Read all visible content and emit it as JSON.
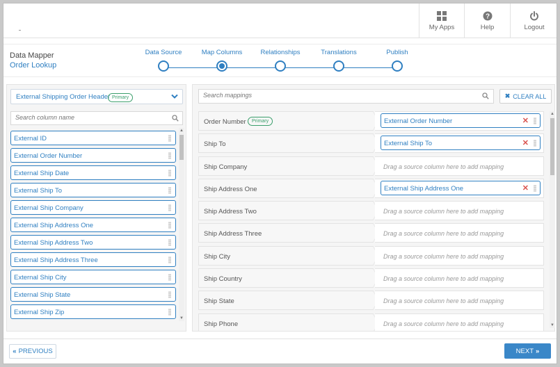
{
  "header": {
    "nav": [
      {
        "label": "My Apps",
        "icon": "grid-icon"
      },
      {
        "label": "Help",
        "icon": "help-icon"
      },
      {
        "label": "Logout",
        "icon": "power-icon"
      }
    ]
  },
  "wizard": {
    "title": "Data Mapper",
    "subtitle": "Order Lookup",
    "steps": [
      {
        "label": "Data Source",
        "active": false
      },
      {
        "label": "Map Columns",
        "active": true
      },
      {
        "label": "Relationships",
        "active": false
      },
      {
        "label": "Translations",
        "active": false
      },
      {
        "label": "Publish",
        "active": false
      }
    ]
  },
  "source": {
    "selected": "External Shipping Order Header",
    "badge": "Primary",
    "search_placeholder": "Search column name",
    "columns": [
      "External ID",
      "External Order Number",
      "External Ship Date",
      "External Ship To",
      "External Ship Company",
      "External Ship Address One",
      "External Ship Address Two",
      "External Ship Address Three",
      "External Ship City",
      "External Ship State",
      "External Ship Zip"
    ]
  },
  "mappings": {
    "search_placeholder": "Search mappings",
    "clear_label": "CLEAR ALL",
    "drop_hint": "Drag a source column here to add mapping",
    "rows": [
      {
        "target": "Order Number",
        "badge": "Primary",
        "source": "External Order Number"
      },
      {
        "target": "Ship To",
        "source": "External Ship To"
      },
      {
        "target": "Ship Company",
        "source": ""
      },
      {
        "target": "Ship Address One",
        "source": "External Ship Address One"
      },
      {
        "target": "Ship Address Two",
        "source": ""
      },
      {
        "target": "Ship Address Three",
        "source": ""
      },
      {
        "target": "Ship City",
        "source": ""
      },
      {
        "target": "Ship Country",
        "source": ""
      },
      {
        "target": "Ship State",
        "source": ""
      },
      {
        "target": "Ship Phone",
        "source": ""
      }
    ]
  },
  "footer": {
    "prev_label": "PREVIOUS",
    "next_label": "NEXT"
  },
  "colors": {
    "accent": "#2f7fc1",
    "primary_badge": "#3a9e6b",
    "remove": "#d9534f",
    "next_button": "#3a87c8"
  }
}
